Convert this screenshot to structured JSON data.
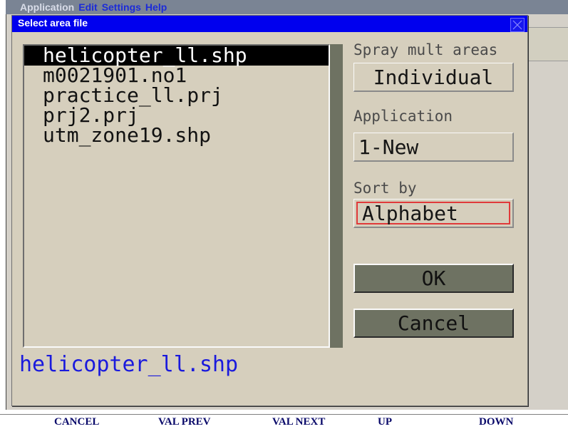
{
  "app": {
    "menu": [
      "Application",
      "Edit",
      "Settings",
      "Help"
    ]
  },
  "dialog": {
    "title": "Select area file",
    "close_icon": "close-icon",
    "files": [
      "helicopter_ll.shp",
      "m0021901.no1",
      "practice_ll.prj",
      "prj2.prj",
      "utm_zone19.shp"
    ],
    "selected_index": 0,
    "spray_label": "Spray mult areas",
    "spray_value": "Individual",
    "application_label": "Application",
    "application_value": "1-New",
    "sort_label": "Sort by",
    "sort_value": "Alphabet",
    "ok_label": "OK",
    "cancel_label": "Cancel",
    "selected_path": "helicopter_ll.shp"
  },
  "softkeys": [
    "CANCEL",
    "VAL PREV",
    "VAL NEXT",
    "UP",
    "DOWN"
  ],
  "colors": {
    "titlebar": "#0000ee",
    "dialog_bg": "#d6cfbd",
    "button_bg": "#6e7262",
    "selection": "#000000",
    "path_text": "#1a1add",
    "focus_border": "#e03a3a"
  }
}
